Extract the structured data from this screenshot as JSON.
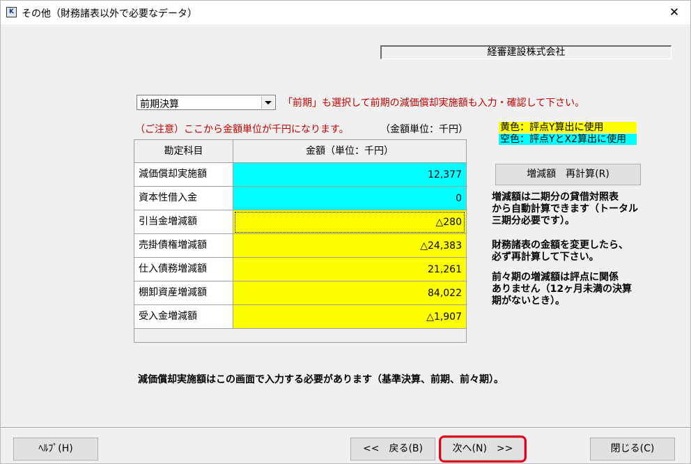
{
  "window": {
    "icon_label": "K",
    "title": "その他（財務諸表以外で必要なデータ）",
    "close_glyph": "✕"
  },
  "company_name": "経審建設株式会社",
  "period_select": {
    "value": "前期決算"
  },
  "notice": "「前期」も選択して前期の減価償却実施額も入力・確認して下さい。",
  "caution": "（ご注意）ここから金額単位が千円になります。",
  "unit_label": "（金額単位：千円）",
  "legend": {
    "yellow": "黄色：評点Y算出に使用",
    "cyan": "空色：評点YとX2算出に使用",
    "yellow_color": "#ffff00",
    "cyan_color": "#00ffff"
  },
  "table": {
    "col_item": "勘定科目",
    "col_amount": "金額（単位：千円）",
    "rows": [
      {
        "item": "減価償却実施額",
        "amount": "12,377",
        "color": "cyan"
      },
      {
        "item": "資本性借入金",
        "amount": "0",
        "color": "cyan"
      },
      {
        "item": "引当金増減額",
        "amount": "△280",
        "color": "yellow"
      },
      {
        "item": "売掛債権増減額",
        "amount": "△24,383",
        "color": "yellow"
      },
      {
        "item": "仕入債務増減額",
        "amount": "21,261",
        "color": "yellow"
      },
      {
        "item": "棚卸資産増減額",
        "amount": "84,022",
        "color": "yellow"
      },
      {
        "item": "受入金増減額",
        "amount": "△1,907",
        "color": "yellow"
      }
    ]
  },
  "recalc_button": "増減額　再計算(R)",
  "info": {
    "p1": "増減額は二期分の貸借対照表\nから自動計算できます（トータル\n三期分必要です）。",
    "p2": "財務諸表の金額を変更したら、\n必ず再計算して下さい。",
    "p3": "前々期の増減額は評点に関係\nありません（12ヶ月未満の決算\n期がないとき）。"
  },
  "bottom_note": "減価償却実施額はこの画面で入力する必要があります（基準決算、前期、前々期）。",
  "buttons": {
    "help": "ﾍﾙﾌﾟ(H)",
    "back": "<<　戻る(B)",
    "next": "次へ(N)　>>",
    "close": "閉じる(C)"
  }
}
